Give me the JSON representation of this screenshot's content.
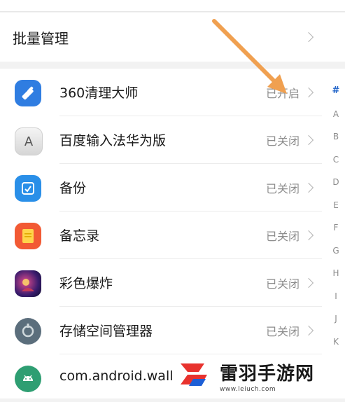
{
  "batch": {
    "label": "批量管理"
  },
  "apps": [
    {
      "name": "360清理大师",
      "status": "已开启",
      "icon": "broom-icon"
    },
    {
      "name": "百度输入法华为版",
      "status": "已关闭",
      "icon": "keyboard-a-icon"
    },
    {
      "name": "备份",
      "status": "已关闭",
      "icon": "backup-icon"
    },
    {
      "name": "备忘录",
      "status": "已关闭",
      "icon": "notepad-icon"
    },
    {
      "name": "彩色爆炸",
      "status": "已关闭",
      "icon": "game-icon"
    },
    {
      "name": "存储空间管理器",
      "status": "已关闭",
      "icon": "storage-icon"
    },
    {
      "name": "com.android.wall",
      "status": "",
      "icon": "android-icon"
    }
  ],
  "index_letters": [
    "#",
    "A",
    "B",
    "C",
    "D",
    "E",
    "F",
    "G",
    "H",
    "I",
    "J",
    "K"
  ],
  "watermark": {
    "title": "雷羽手游网",
    "url": "www.leiuch.com"
  },
  "colors": {
    "arrow": "#f0a050",
    "index_active": "#1e62c8"
  }
}
